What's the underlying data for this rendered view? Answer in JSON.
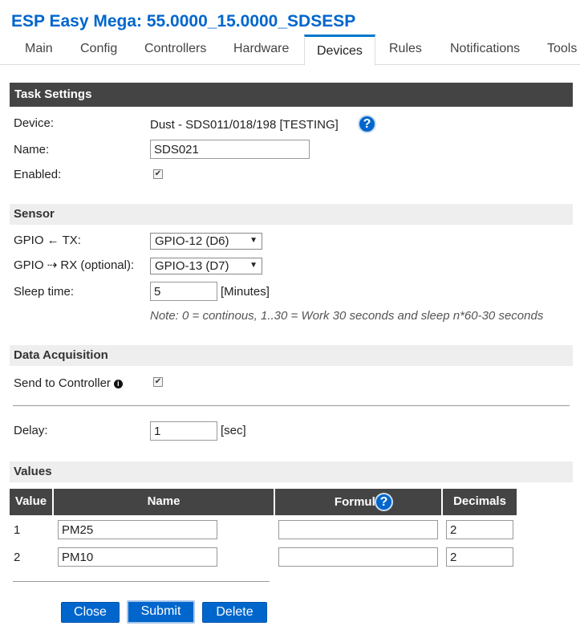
{
  "app": {
    "title": "ESP Easy Mega: 55.0000_15.0000_SDSESP"
  },
  "tabs": [
    {
      "label": "Main",
      "active": false
    },
    {
      "label": "Config",
      "active": false
    },
    {
      "label": "Controllers",
      "active": false
    },
    {
      "label": "Hardware",
      "active": false
    },
    {
      "label": "Devices",
      "active": true
    },
    {
      "label": "Rules",
      "active": false
    },
    {
      "label": "Notifications",
      "active": false
    },
    {
      "label": "Tools",
      "active": false
    }
  ],
  "task_settings": {
    "header": "Task Settings",
    "device_label": "Device:",
    "device_value": "Dust - SDS011/018/198 [TESTING]",
    "help_glyph": "?",
    "name_label": "Name:",
    "name_value": "SDS021",
    "enabled_label": "Enabled:",
    "enabled_checked": true
  },
  "sensor": {
    "header": "Sensor",
    "gpio_tx_label": "GPIO ← TX:",
    "gpio_tx_value": "GPIO-12 (D6)",
    "gpio_rx_label": "GPIO ⇢ RX (optional):",
    "gpio_rx_value": "GPIO-13 (D7)",
    "sleep_label": "Sleep time:",
    "sleep_value": "5",
    "sleep_unit": "[Minutes]",
    "note": "Note: 0 = continous, 1..30 = Work 30 seconds and sleep n*60-30 seconds"
  },
  "data_acquisition": {
    "header": "Data Acquisition",
    "send_label": "Send to Controller",
    "send_checked": true,
    "delay_label": "Delay:",
    "delay_value": "1",
    "delay_unit": "[sec]"
  },
  "values": {
    "header": "Values",
    "columns": [
      "Value",
      "Name",
      "Formula",
      "Decimals"
    ],
    "rows": [
      {
        "index": "1",
        "name": "PM25",
        "formula": "",
        "decimals": "2"
      },
      {
        "index": "2",
        "name": "PM10",
        "formula": "",
        "decimals": "2"
      }
    ]
  },
  "buttons": {
    "close": "Close",
    "submit": "Submit",
    "delete": "Delete"
  },
  "colors": {
    "accent": "#0066cc",
    "header_dark": "#444444",
    "header_light": "#eeeeee"
  }
}
